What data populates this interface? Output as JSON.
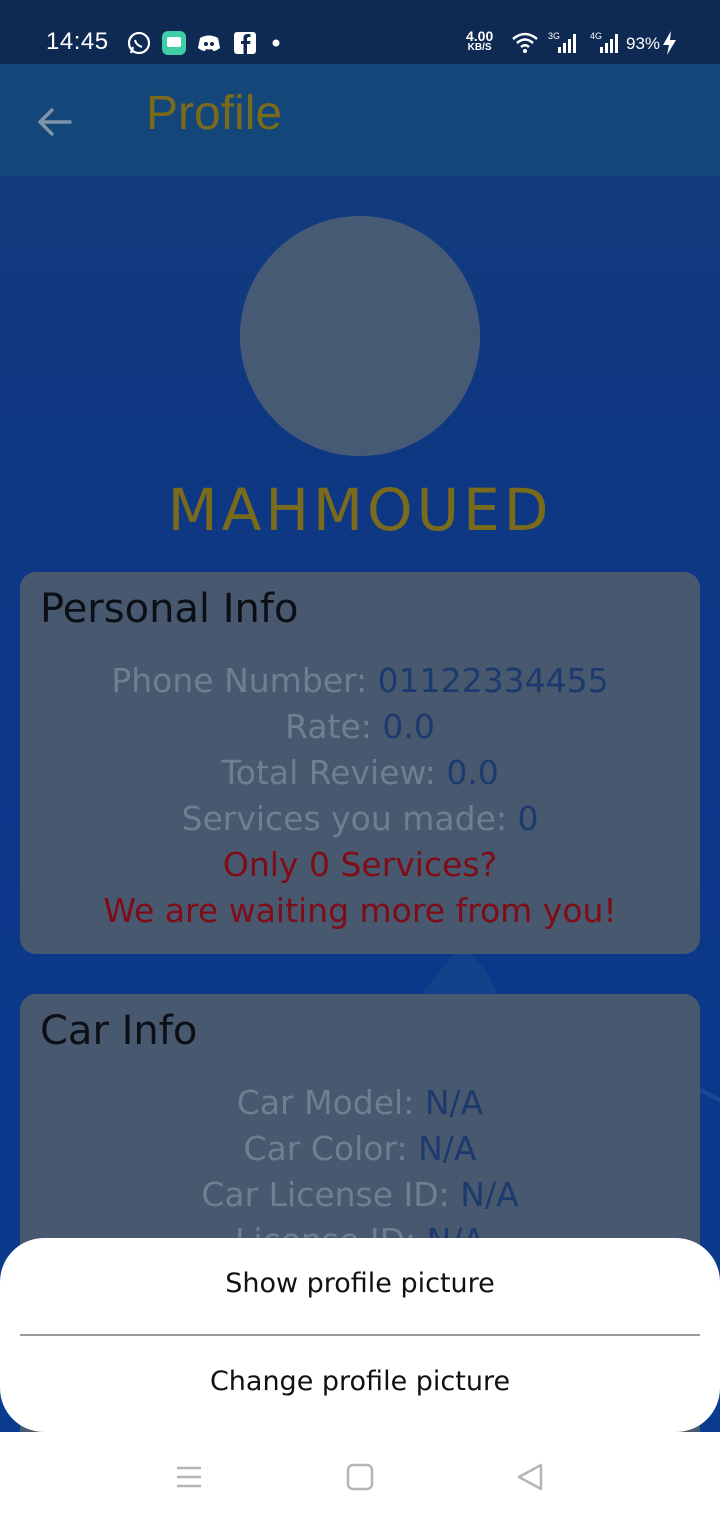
{
  "status_bar": {
    "time": "14:45",
    "net_speed_value": "4.00",
    "net_speed_unit": "KB/S",
    "network_3g": "3G",
    "network_4g": "4G",
    "battery": "93%"
  },
  "app_bar": {
    "title": "Profile"
  },
  "profile": {
    "name": "MAHMOUED"
  },
  "personal_info": {
    "title": "Personal Info",
    "phone_label": "Phone Number: ",
    "phone_value": "01122334455",
    "rate_label": "Rate: ",
    "rate_value": "0.0",
    "review_label": "Total Review: ",
    "review_value": "0.0",
    "services_label": "Services you made: ",
    "services_value": "0",
    "warning_1": "Only 0 Services?",
    "warning_2": "We are waiting more from you!"
  },
  "car_info": {
    "title": "Car Info",
    "model_label": "Car Model: ",
    "model_value": "N/A",
    "color_label": "Car Color: ",
    "color_value": "N/A",
    "license_label": "Car License ID: ",
    "license_value": "N/A",
    "driver_license_label": "License ID: ",
    "driver_license_value": "N/A"
  },
  "sheet": {
    "show_picture": "Show profile picture",
    "change_picture": "Change profile picture"
  },
  "colors": {
    "accent_gold": "#7a6a1c",
    "app_bar": "#134679",
    "card": "#47586f",
    "warning": "#7e0d17"
  }
}
